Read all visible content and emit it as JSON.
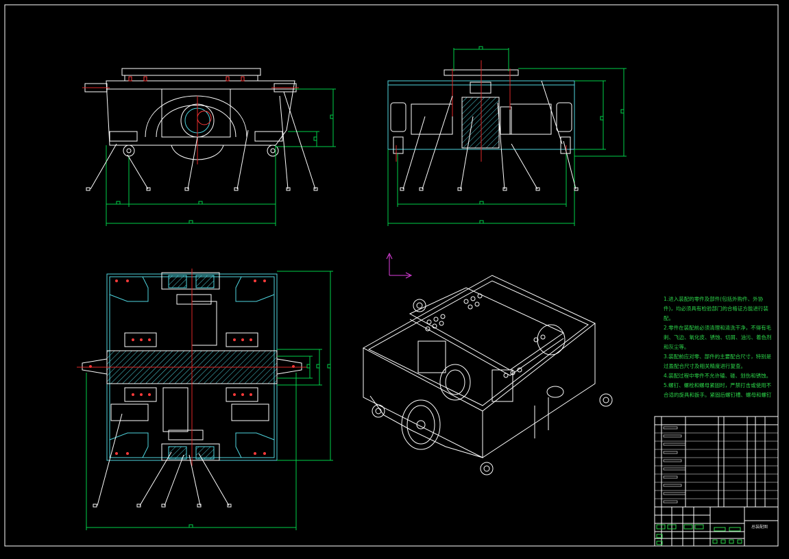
{
  "notes": [
    "1.进入装配的零件及部件(包括外购件、外协",
    "件)，均必须具有检验部门的合格证方能进行装",
    "配。",
    "2.零件在装配前必须清理和清洗干净，不得有毛",
    "刺、飞边、氧化皮、锈蚀、切屑、油污、着色剂",
    "和灰尘等。",
    "3.装配前应对零、部件的主要配合尺寸，特别是",
    "过盈配合尺寸及相关精度进行复查。",
    "4.装配过程中零件不允许磕、碰、划伤和锈蚀。",
    "5.螺钉、螺栓和螺母紧固时，严禁打击或使用不",
    "合适的旋具和扳手。紧固后螺钉槽、螺母和螺钉"
  ],
  "title_block": {
    "drawing_name": "总装配图"
  },
  "colors": {
    "background": "#000000",
    "outline": "#ffffff",
    "dimension": "#00d24a",
    "hidden": "#4fd6e0",
    "centerline": "#e02828",
    "note": "#2cd64a",
    "ucs": "#e040e0",
    "hatch": "#4fd6e0"
  }
}
